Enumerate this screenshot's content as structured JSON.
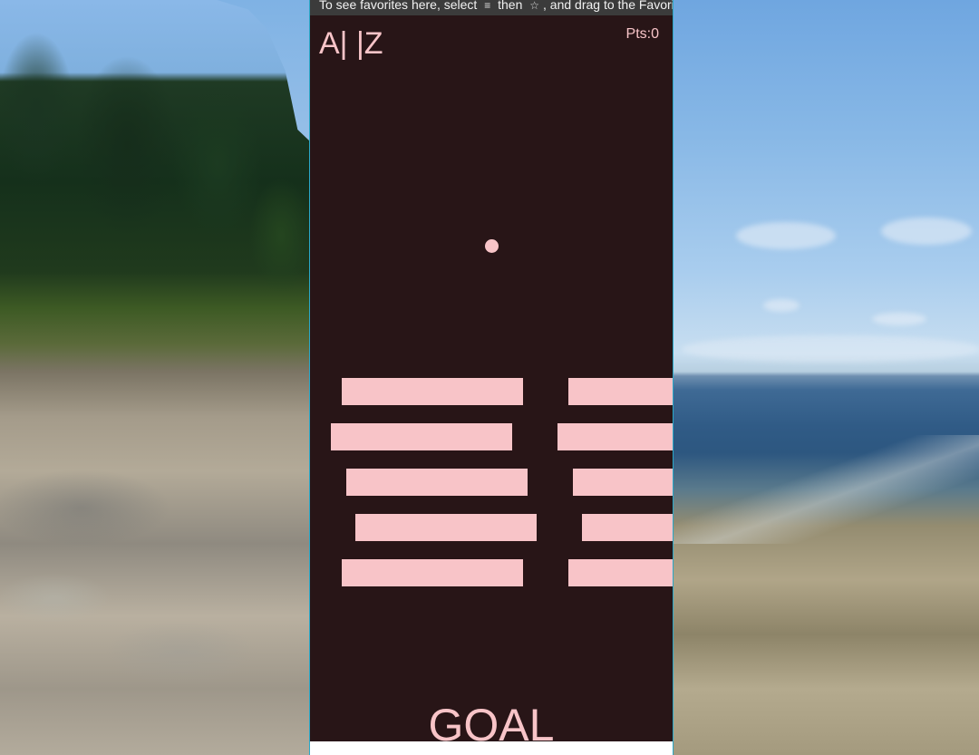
{
  "favorites_bar": {
    "text_before": "To see favorites here, select",
    "icon_menu": "≡",
    "text_middle": "then",
    "icon_star": "☆",
    "text_after": ", and drag to the Favorites bar"
  },
  "controls": {
    "left_label": "A|",
    "right_label": "|Z"
  },
  "score": {
    "label": "Pts:0"
  },
  "goal": {
    "label": "GOAL"
  },
  "colors": {
    "game_background": "#281517",
    "foreground_pink": "#f8c4c8",
    "window_border": "#2aa8c8"
  },
  "icons": [
    "menu-icon",
    "star-icon",
    "ball-icon"
  ],
  "obstacles": {
    "rows": 5,
    "bars_per_row": 2
  }
}
